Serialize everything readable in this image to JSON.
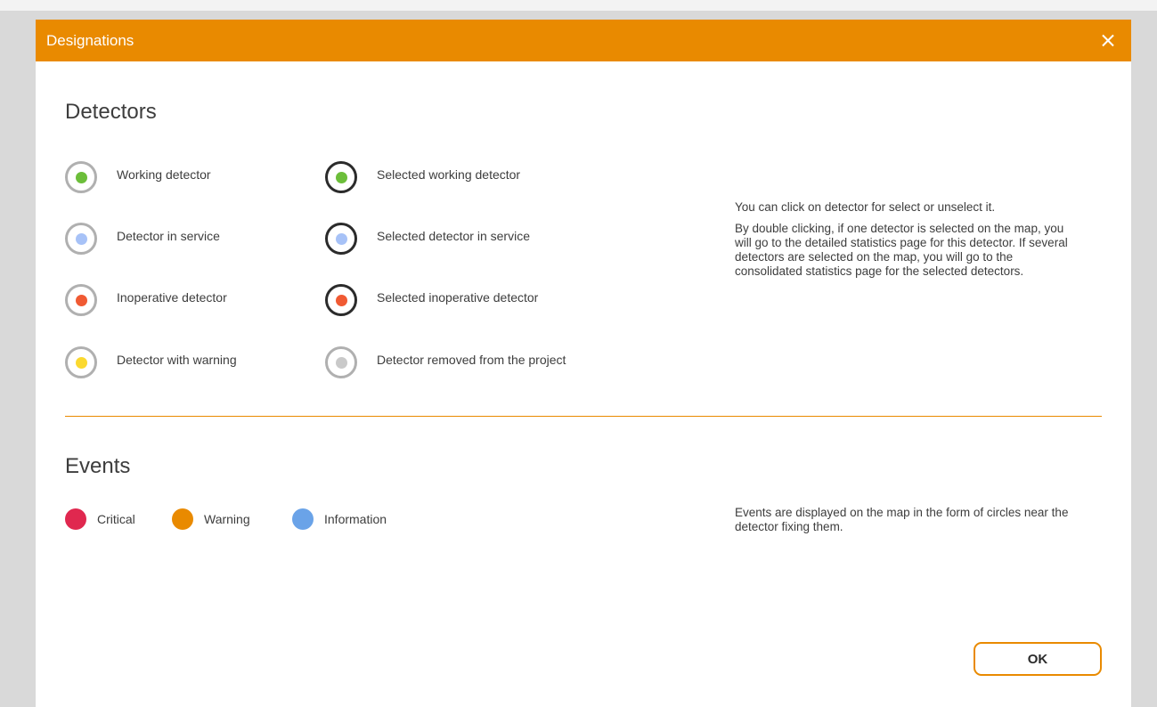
{
  "dialog": {
    "title": "Designations",
    "close_icon": "close-icon",
    "ok_label": "OK"
  },
  "detectors": {
    "title": "Detectors",
    "legend": [
      {
        "label": "Working detector",
        "dot_color": "#6cbe3a",
        "selected": false
      },
      {
        "label": "Detector in service",
        "dot_color": "#a7c2f7",
        "selected": false
      },
      {
        "label": "Inoperative detector",
        "dot_color": "#f05a33",
        "selected": false
      },
      {
        "label": "Detector with warning",
        "dot_color": "#fbd92f",
        "selected": false
      },
      {
        "label": "Selected working detector",
        "dot_color": "#6cbe3a",
        "selected": true
      },
      {
        "label": "Selected detector in service",
        "dot_color": "#a7c2f7",
        "selected": true
      },
      {
        "label": "Selected inoperative detector",
        "dot_color": "#f05a33",
        "selected": true
      },
      {
        "label": "Detector removed from the project",
        "dot_color": "#c9c9c9",
        "selected": false
      }
    ],
    "info": [
      "You can click on detector for select or unselect it.",
      "By double clicking, if one detector is selected on the map, you will go to the detailed statistics page for this detector. If several detectors are selected on the map, you will go to the consolidated statistics page for the selected detectors."
    ]
  },
  "events": {
    "title": "Events",
    "legend": [
      {
        "label": "Critical",
        "color": "#e0284f"
      },
      {
        "label": "Warning",
        "color": "#e98a00"
      },
      {
        "label": "Information",
        "color": "#6aa3e8"
      }
    ],
    "info": "Events are displayed on the map in the form of circles near the detector fixing them."
  },
  "colors": {
    "accent": "#e98a00",
    "text": "#3d3d3d"
  }
}
